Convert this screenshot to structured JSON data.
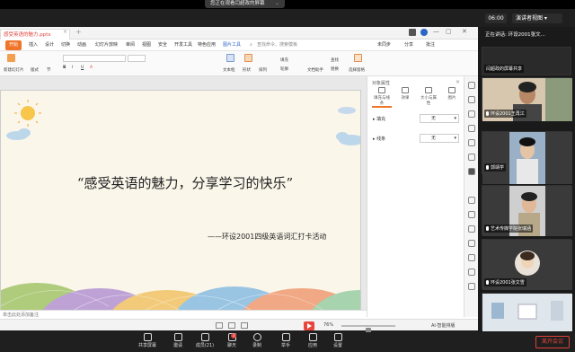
{
  "banner": {
    "viewing_text": "您正在观看闫超政的屏幕"
  },
  "meeting": {
    "clock": "06:00",
    "view_mode": "演讲者视图",
    "sharing_label": "正在讲话: 环设2001张文..."
  },
  "wps": {
    "doc_tab": "感受英语的魅力.pptx",
    "menus": [
      "开始",
      "插入",
      "设计",
      "切换",
      "动画",
      "幻灯片放映",
      "审阅",
      "视图",
      "安全",
      "开发工具",
      "特色应用",
      "图片工具"
    ],
    "search_placeholder": "查找命令、搜索模板",
    "share": "分享",
    "annotation": "批注",
    "unsynced": "未同步",
    "ribbon": {
      "new_slide": "新建幻灯片",
      "layout": "版式",
      "section": "节",
      "text_box": "文本框",
      "shape": "形状",
      "arrange": "排列",
      "fill": "填充",
      "outline": "轮廓",
      "find": "查找",
      "replace": "替换",
      "select_pane": "选择窗格",
      "text_tools": "文档助手"
    },
    "slide": {
      "title": "“感受英语的魅力，分享学习的快乐”",
      "subtitle": "——环设2001四级英语词汇打卡活动"
    },
    "notes_placeholder": "单击此处添加备注",
    "zoom": "76%",
    "ai_label": "AI·智能排版"
  },
  "panel": {
    "title": "对象属性",
    "tabs": [
      "填充与线条",
      "效果",
      "大小与属性",
      "图片"
    ],
    "fill_label": "填充",
    "fill_value": "无",
    "line_label": "线条",
    "line_value": "无"
  },
  "participants": [
    {
      "name": "闫超政的屏幕共享"
    },
    {
      "name": "环设2001王再江"
    },
    {
      "name": "郭靖学"
    },
    {
      "name": "艺术传媒学院张瑞涵"
    },
    {
      "name": "环设2001张文雪"
    },
    {
      "name": ""
    }
  ],
  "toolbar": {
    "items": [
      "共享屏幕",
      "邀请",
      "成员(21)",
      "聊天",
      "录制",
      "举手",
      "应用",
      "设置"
    ],
    "chat_badge": "3",
    "leave": "离开会议"
  },
  "colors": {
    "accent": "#f0752a",
    "danger": "#e0403a"
  }
}
